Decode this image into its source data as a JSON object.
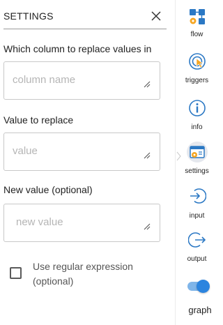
{
  "panel": {
    "title": "SETTINGS",
    "fields": [
      {
        "label": "Which column to replace values in",
        "placeholder": "column name",
        "value": ""
      },
      {
        "label": "Value to replace",
        "placeholder": "value",
        "value": ""
      },
      {
        "label": "New value (optional)",
        "placeholder": "new value",
        "value": ""
      }
    ],
    "checkbox": {
      "label": "Use regular expression (optional)",
      "checked": false
    }
  },
  "sidebar": {
    "items": [
      {
        "label": "flow",
        "icon": "flow-icon"
      },
      {
        "label": "triggers",
        "icon": "triggers-icon"
      },
      {
        "label": "info",
        "icon": "info-icon"
      },
      {
        "label": "settings",
        "icon": "settings-icon",
        "active": true
      },
      {
        "label": "input",
        "icon": "input-icon"
      },
      {
        "label": "output",
        "icon": "output-icon"
      }
    ],
    "toggle": {
      "label": "graph",
      "on": true
    }
  },
  "colors": {
    "accent": "#2b84df",
    "accent_light": "#7fb5e9",
    "active_bg": "#e5e8ee",
    "orange": "#f5a623",
    "icon_blue": "#2b78c4"
  }
}
